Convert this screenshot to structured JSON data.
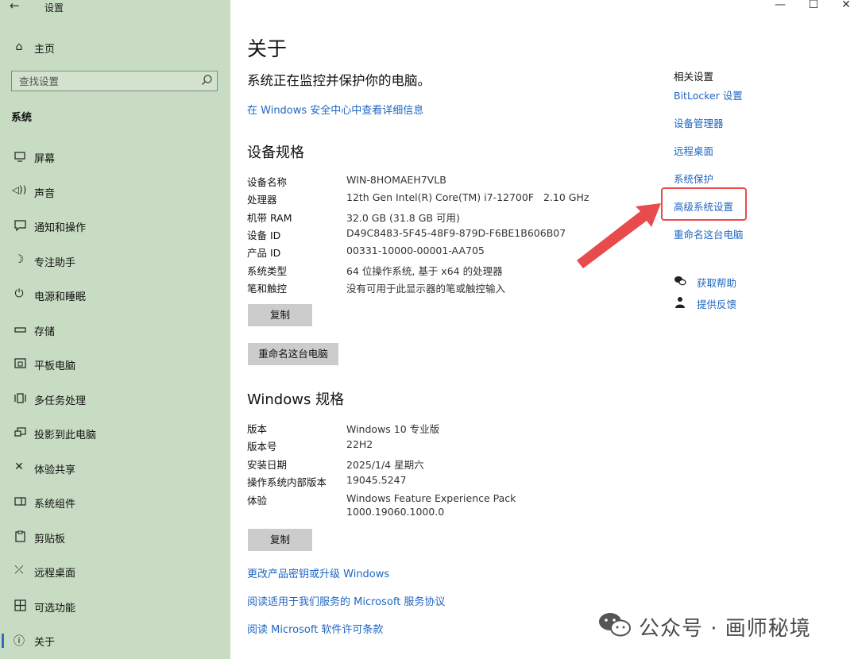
{
  "window": {
    "title": "设置",
    "controls": {
      "minimize": "—",
      "maximize": "☐",
      "close": "✕"
    }
  },
  "sidebar": {
    "home_label": "主页",
    "search_placeholder": "查找设置",
    "section_title": "系统",
    "items": [
      {
        "label": "屏幕",
        "icon": "monitor-icon"
      },
      {
        "label": "声音",
        "icon": "speaker-icon"
      },
      {
        "label": "通知和操作",
        "icon": "notification-icon"
      },
      {
        "label": "专注助手",
        "icon": "moon-icon"
      },
      {
        "label": "电源和睡眠",
        "icon": "power-icon"
      },
      {
        "label": "存储",
        "icon": "storage-icon"
      },
      {
        "label": "平板电脑",
        "icon": "tablet-icon"
      },
      {
        "label": "多任务处理",
        "icon": "multitask-icon"
      },
      {
        "label": "投影到此电脑",
        "icon": "project-icon"
      },
      {
        "label": "体验共享",
        "icon": "share-icon"
      },
      {
        "label": "系统组件",
        "icon": "components-icon"
      },
      {
        "label": "剪贴板",
        "icon": "clipboard-icon"
      },
      {
        "label": "远程桌面",
        "icon": "remote-desktop-icon"
      },
      {
        "label": "可选功能",
        "icon": "optional-features-icon"
      },
      {
        "label": "关于",
        "icon": "info-icon",
        "active": true
      }
    ]
  },
  "main": {
    "title": "关于",
    "protect_text": "系统正在监控并保护你的电脑。",
    "security_link": "在 Windows 安全中心中查看详细信息",
    "device_specs_title": "设备规格",
    "device_specs": [
      {
        "label": "设备名称",
        "value": "WIN-8HOMAEH7VLB"
      },
      {
        "label": "处理器",
        "value": "12th Gen Intel(R) Core(TM) i7-12700F   2.10 GHz"
      },
      {
        "label": "机带 RAM",
        "value": "32.0 GB (31.8 GB 可用)"
      },
      {
        "label": "设备 ID",
        "value": "D49C8483-5F45-48F9-879D-F6BE1B606B07"
      },
      {
        "label": "产品 ID",
        "value": "00331-10000-00001-AA705"
      },
      {
        "label": "系统类型",
        "value": "64 位操作系统, 基于 x64 的处理器"
      },
      {
        "label": "笔和触控",
        "value": "没有可用于此显示器的笔或触控输入"
      }
    ],
    "copy_button_1": "复制",
    "rename_button": "重命名这台电脑",
    "windows_specs_title": "Windows 规格",
    "windows_specs": [
      {
        "label": "版本",
        "value": "Windows 10 专业版"
      },
      {
        "label": "版本号",
        "value": "22H2"
      },
      {
        "label": "安装日期",
        "value": "2025/1/4 星期六"
      },
      {
        "label": "操作系统内部版本",
        "value": "19045.5247"
      },
      {
        "label": "体验",
        "value": "Windows Feature Experience Pack",
        "value2": "1000.19060.1000.0"
      }
    ],
    "copy_button_2": "复制",
    "links": [
      "更改产品密钥或升级 Windows",
      "阅读适用于我们服务的 Microsoft 服务协议",
      "阅读 Microsoft 软件许可条款"
    ]
  },
  "related": {
    "title": "相关设置",
    "links": [
      "BitLocker 设置",
      "设备管理器",
      "远程桌面",
      "系统保护",
      "高级系统设置",
      "重命名这台电脑"
    ],
    "highlighted": "高级系统设置",
    "help": [
      {
        "label": "获取帮助",
        "icon": "help-chat-icon"
      },
      {
        "label": "提供反馈",
        "icon": "feedback-icon"
      }
    ]
  },
  "watermark": {
    "text": "公众号 · 画师秘境"
  },
  "colors": {
    "sidebar_bg": "#c7dcc2",
    "link": "#1f66c2",
    "highlight": "#e84b4b",
    "accent": "#2f6cc4"
  }
}
